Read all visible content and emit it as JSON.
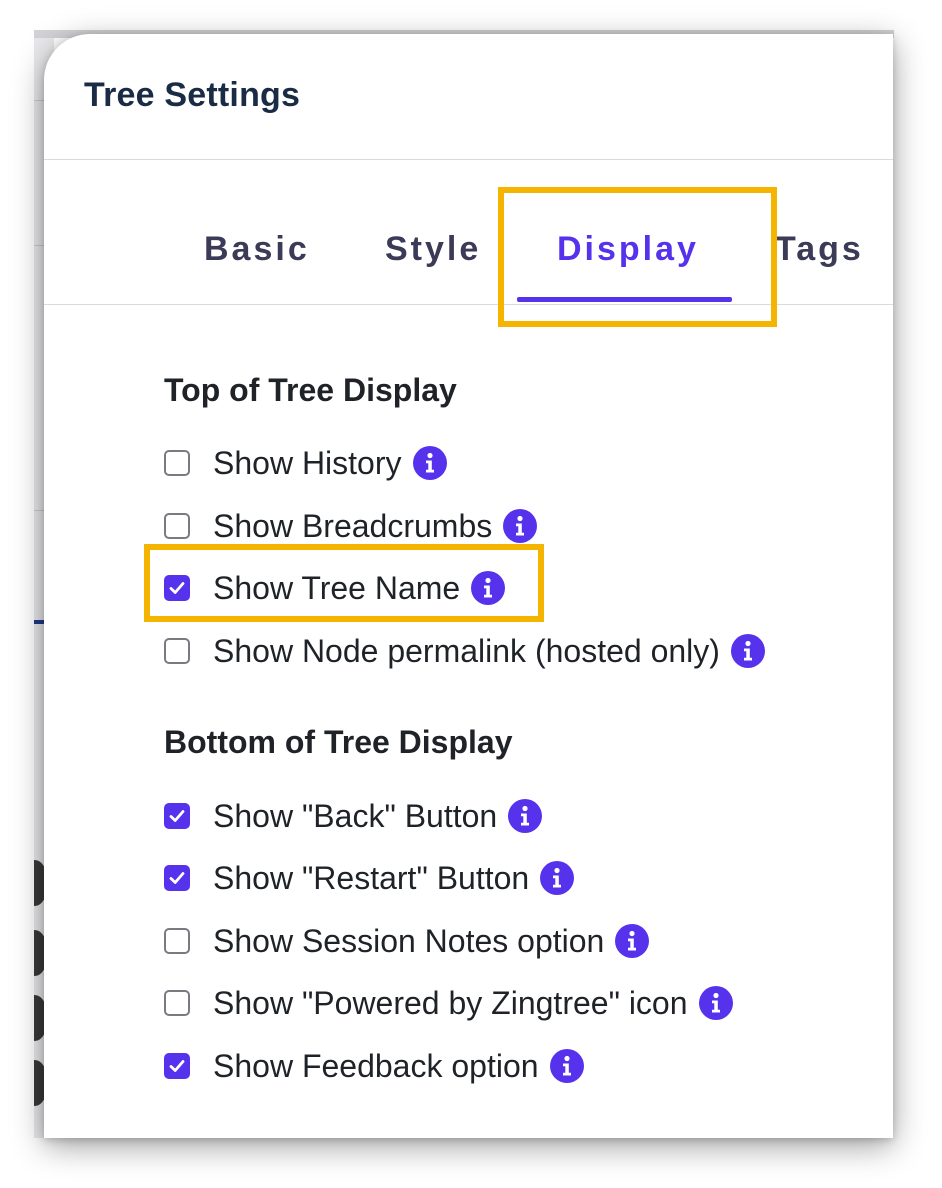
{
  "modal": {
    "title": "Tree Settings"
  },
  "tabs": [
    {
      "label": "Basic",
      "active": false
    },
    {
      "label": "Style",
      "active": false
    },
    {
      "label": "Display",
      "active": true
    },
    {
      "label": "Tags",
      "active": false
    }
  ],
  "sections": {
    "top": {
      "title": "Top of Tree Display",
      "options": [
        {
          "label": "Show History",
          "checked": false
        },
        {
          "label": "Show Breadcrumbs",
          "checked": false
        },
        {
          "label": "Show Tree Name",
          "checked": true
        },
        {
          "label": "Show Node permalink (hosted only)",
          "checked": false
        }
      ]
    },
    "bottom": {
      "title": "Bottom of Tree Display",
      "options": [
        {
          "label": "Show \"Back\" Button",
          "checked": true
        },
        {
          "label": "Show \"Restart\" Button",
          "checked": true
        },
        {
          "label": "Show Session Notes option",
          "checked": false
        },
        {
          "label": "Show \"Powered by Zingtree\" icon",
          "checked": false
        },
        {
          "label": "Show Feedback option",
          "checked": true
        }
      ]
    }
  },
  "icons": {
    "info": "info-icon",
    "check": "check-icon"
  },
  "colors": {
    "accent": "#5632ec",
    "highlight": "#f5b400",
    "title": "#1a2b45",
    "tab_inactive": "#3b3a57",
    "text": "#1f2328"
  }
}
